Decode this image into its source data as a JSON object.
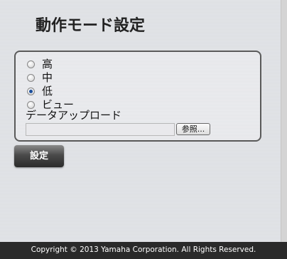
{
  "page": {
    "title": "動作モード設定"
  },
  "mode_options": [
    {
      "label": "高",
      "checked": false
    },
    {
      "label": "中",
      "checked": false
    },
    {
      "label": "低",
      "checked": true
    },
    {
      "label": "ビュー",
      "checked": false
    }
  ],
  "upload": {
    "label": "データアップロード",
    "file_value": "",
    "browse_label": "参照..."
  },
  "submit": {
    "label": "設定"
  },
  "footer": {
    "copyright": "Copyright © 2013 Yamaha Corporation. All Rights Reserved."
  }
}
